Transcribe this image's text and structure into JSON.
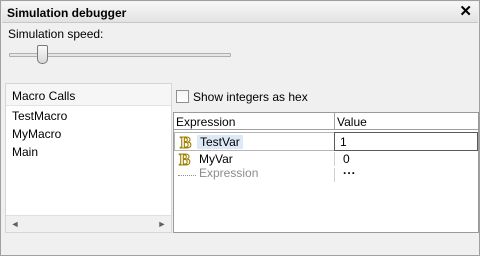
{
  "window": {
    "title": "Simulation debugger",
    "close_glyph": "✕"
  },
  "speed": {
    "label": "Simulation speed:",
    "level_fraction": 0.15
  },
  "macro_calls": {
    "header": "Macro Calls",
    "items": [
      "TestMacro",
      "MyMacro",
      "Main"
    ],
    "scroll_left_glyph": "◄",
    "scroll_right_glyph": "►"
  },
  "options": {
    "hex_label": "Show integers as hex",
    "hex_checked": false
  },
  "watch": {
    "columns": {
      "expression": "Expression",
      "value": "Value"
    },
    "rows": [
      {
        "name": "TestVar",
        "value": "1",
        "icon": "variable-b-icon",
        "editing": true
      },
      {
        "name": "MyVar",
        "value": "0",
        "icon": "variable-b-icon",
        "editing": false
      }
    ],
    "new_row": {
      "placeholder": "Expression",
      "value": "..."
    }
  },
  "colors": {
    "icon_gold": "#c8a000",
    "selection": "#dde9f7"
  }
}
